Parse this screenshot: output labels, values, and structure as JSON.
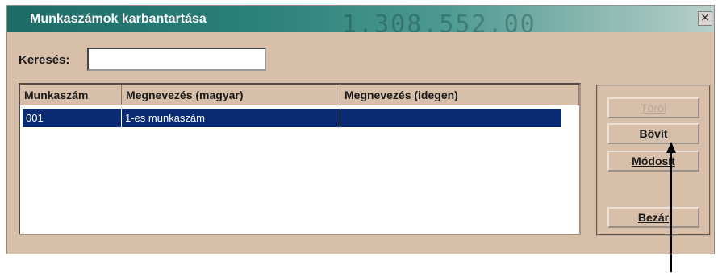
{
  "window": {
    "title": "Munkaszámok karbantartása",
    "title_decoration": "1.308.552,00",
    "close_label": "×"
  },
  "search": {
    "label": "Keresés:",
    "value": ""
  },
  "grid": {
    "columns": [
      "Munkaszám",
      "Megnevezés (magyar)",
      "Megnevezés (idegen)"
    ],
    "rows": [
      [
        "001",
        "1-es munkaszám",
        ""
      ]
    ]
  },
  "buttons": {
    "torol": "Töröl",
    "bovit": "Bővít",
    "modosit": "Módosít",
    "bezar": "Bezár"
  },
  "colors": {
    "title_gradient_start": "#1d6b67",
    "window_bg": "#d8bfa9",
    "selection": "#0a2a74"
  }
}
